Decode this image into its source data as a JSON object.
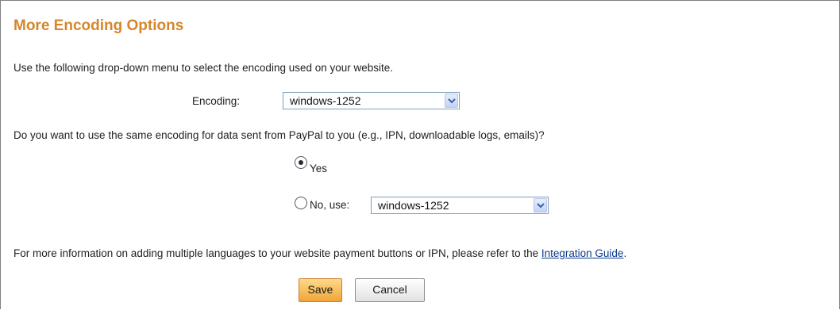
{
  "section": {
    "title": "More Encoding Options",
    "intro": "Use the following drop-down menu to select the encoding used on your website."
  },
  "encoding": {
    "label": "Encoding:",
    "selected": "windows-1252"
  },
  "same_encoding": {
    "question": "Do you want to use the same encoding for data sent from PayPal to you (e.g., IPN, downloadable logs, emails)?",
    "yes_label": "Yes",
    "no_label": "No, use:",
    "selected_option": "Yes",
    "no_select_value": "windows-1252"
  },
  "info": {
    "text": "For more information on adding multiple languages to your website payment buttons or IPN, please refer to the ",
    "link_text": "Integration Guide",
    "trailing": "."
  },
  "buttons": {
    "save_label": "Save",
    "cancel_label": "Cancel"
  },
  "colors": {
    "title": "#d5862b",
    "link": "#0b3b8c",
    "save_button": "#f0a536"
  },
  "icons": {
    "dropdown": "chevron-down-icon"
  }
}
